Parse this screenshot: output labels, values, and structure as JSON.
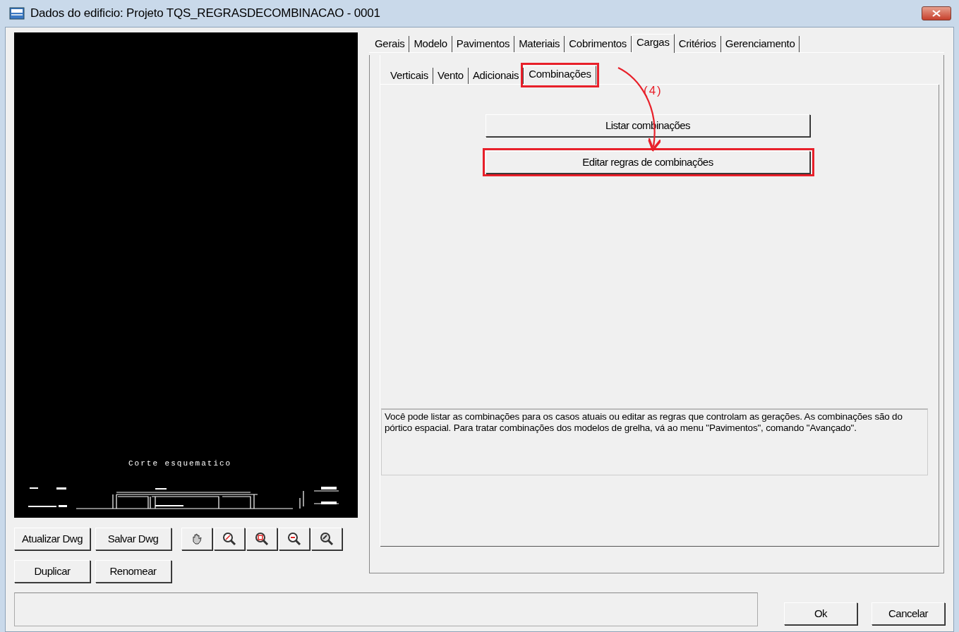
{
  "window": {
    "title": "Dados do edificio: Projeto TQS_REGRASDECOMBINACAO - 0001"
  },
  "preview": {
    "caption": "Corte esquematico"
  },
  "preview_buttons": [
    {
      "label": "Atualizar Dwg"
    },
    {
      "label": "Salvar Dwg"
    }
  ],
  "zoom_tools": [
    {
      "kind": "pan"
    },
    {
      "kind": "zoom_window"
    },
    {
      "kind": "zoom_all"
    },
    {
      "kind": "zoom_out"
    },
    {
      "kind": "zoom_previous"
    }
  ],
  "file_buttons": [
    {
      "label": "Duplicar"
    },
    {
      "label": "Renomear"
    }
  ],
  "tabs": [
    {
      "label": "Gerais",
      "selected": false
    },
    {
      "label": "Modelo",
      "selected": false
    },
    {
      "label": "Pavimentos",
      "selected": false
    },
    {
      "label": "Materiais",
      "selected": false
    },
    {
      "label": "Cobrimentos",
      "selected": false
    },
    {
      "label": "Cargas",
      "selected": true
    },
    {
      "label": "Critérios",
      "selected": false
    },
    {
      "label": "Gerenciamento",
      "selected": false
    }
  ],
  "subtabs": [
    {
      "label": "Verticais",
      "selected": false,
      "highlighted": false
    },
    {
      "label": "Vento",
      "selected": false,
      "highlighted": false
    },
    {
      "label": "Adicionais",
      "selected": false,
      "highlighted": false
    },
    {
      "label": "Combinações",
      "selected": true,
      "highlighted": true
    }
  ],
  "actions": [
    {
      "label": "Listar combinações",
      "highlighted": false
    },
    {
      "label": "Editar regras de combinações",
      "highlighted": true
    }
  ],
  "description": "Você pode listar as combinações para os casos atuais ou editar as regras que controlam as gerações. As combinações são do pórtico espacial. Para tratar combinações dos modelos de grelha, vá ao menu \"Pavimentos\", comando \"Avançado\".",
  "annotation": {
    "label": "(4)"
  },
  "dialog_buttons": [
    {
      "label": "Ok"
    },
    {
      "label": "Cancelar"
    }
  ]
}
